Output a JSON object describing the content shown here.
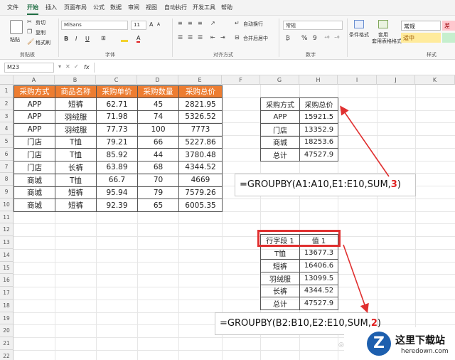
{
  "menu": {
    "items": [
      "文件",
      "开始",
      "插入",
      "页面布局",
      "公式",
      "数据",
      "审阅",
      "视图",
      "自动执行",
      "开发工具",
      "帮助"
    ],
    "active_index": 1
  },
  "ribbon": {
    "clipboard": {
      "paste": "粘贴",
      "cut": "剪切",
      "copy": "复制",
      "format_painter": "格式刷",
      "group": "剪贴板"
    },
    "font": {
      "name": "MiSans",
      "size": "11",
      "bold": "B",
      "italic": "I",
      "underline": "U",
      "font_color": "A",
      "grow": "A",
      "shrink": "A",
      "group": "字体"
    },
    "alignment": {
      "wrap": "自动换行",
      "merge": "合并后居中",
      "group": "对齐方式"
    },
    "number": {
      "format": "常规",
      "percent": "%",
      "comma": "9",
      "group": "数字"
    },
    "styles": {
      "conditional": "条件格式",
      "table": "套用表格格式",
      "normal": "常规",
      "bad": "差",
      "neutral": "适中",
      "group": "样式"
    }
  },
  "formula_bar": {
    "name_box": "M23",
    "fx": "fx",
    "value": ""
  },
  "columns": [
    "A",
    "B",
    "C",
    "D",
    "E",
    "F",
    "G",
    "H",
    "I",
    "J",
    "K"
  ],
  "rows": [
    "1",
    "2",
    "3",
    "4",
    "5",
    "6",
    "7",
    "8",
    "9",
    "10",
    "11",
    "12",
    "13",
    "14",
    "15",
    "16",
    "17",
    "18",
    "19",
    "20",
    "21",
    "22",
    "23"
  ],
  "table": {
    "headers": [
      "采购方式",
      "商品名称",
      "采购单价",
      "采购数量",
      "采购总价"
    ],
    "rows": [
      [
        "APP",
        "短裤",
        "62.71",
        "45",
        "2821.95"
      ],
      [
        "APP",
        "羽绒服",
        "71.98",
        "74",
        "5326.52"
      ],
      [
        "APP",
        "羽绒服",
        "77.73",
        "100",
        "7773"
      ],
      [
        "门店",
        "T恤",
        "79.21",
        "66",
        "5227.86"
      ],
      [
        "门店",
        "T恤",
        "85.92",
        "44",
        "3780.48"
      ],
      [
        "门店",
        "长裤",
        "63.89",
        "68",
        "4344.52"
      ],
      [
        "商城",
        "T恤",
        "66.7",
        "70",
        "4669"
      ],
      [
        "商城",
        "短裤",
        "95.94",
        "79",
        "7579.26"
      ],
      [
        "商城",
        "短裤",
        "92.39",
        "65",
        "6005.35"
      ]
    ]
  },
  "result1": {
    "headers": [
      "采购方式",
      "采购总价"
    ],
    "rows": [
      [
        "APP",
        "15921.5"
      ],
      [
        "门店",
        "13352.9"
      ],
      [
        "商城",
        "18253.6"
      ],
      [
        "总计",
        "47527.9"
      ]
    ]
  },
  "formula1": {
    "prefix": "=GROUPBY(A1:A10,E1:E10,SUM,",
    "highlight": "3",
    "suffix": ")"
  },
  "result2": {
    "headers": [
      "行字段 1",
      "值 1"
    ],
    "rows": [
      [
        "T恤",
        "13677.3"
      ],
      [
        "短裤",
        "16406.6"
      ],
      [
        "羽绒服",
        "13099.5"
      ],
      [
        "长裤",
        "4344.52"
      ],
      [
        "总计",
        "47527.9"
      ]
    ]
  },
  "formula2": {
    "prefix": "=GROUPBY(B2:B10,E2:E10,SUM,",
    "highlight": "2",
    "suffix": ")"
  },
  "watermark": {
    "brand": "这里下载站",
    "url": "heredown.com",
    "logo_letter": "Z"
  },
  "colors": {
    "header_orange": "#ed7d31",
    "accent_green": "#1f6e43",
    "annotation_red": "#e03030"
  }
}
